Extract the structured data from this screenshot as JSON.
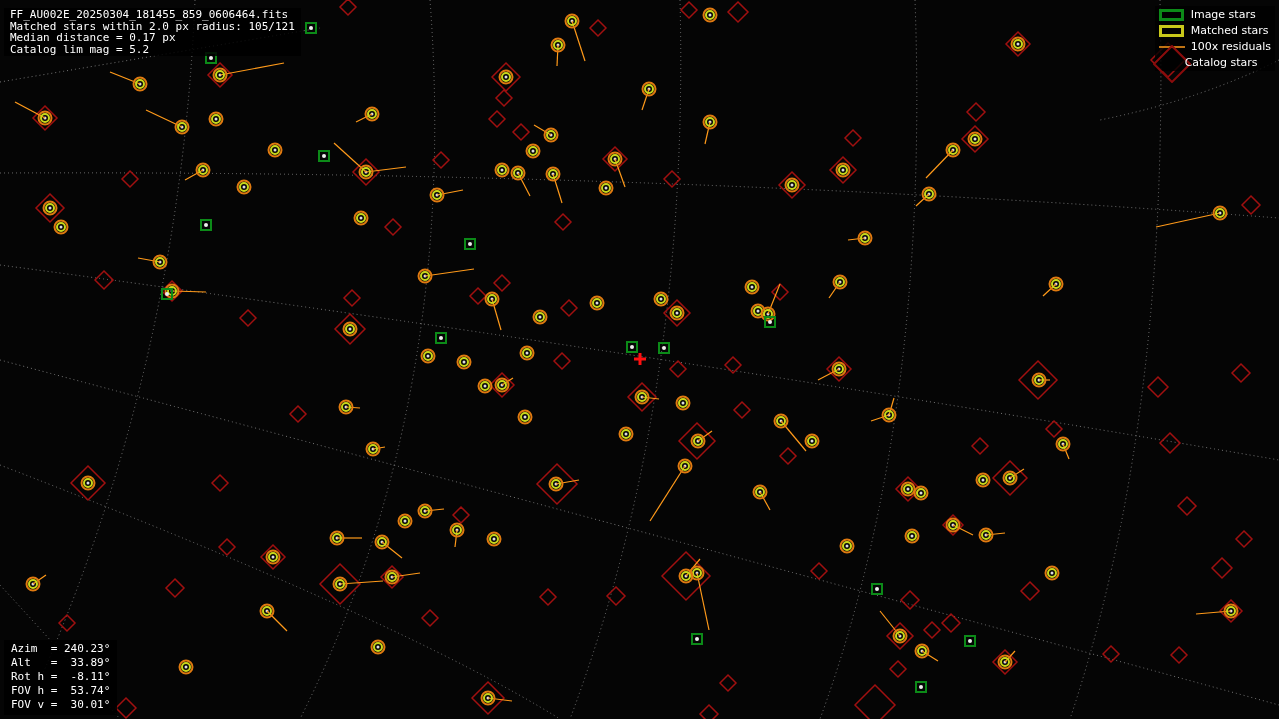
{
  "info": {
    "lines": [
      "FF_AU002E_20250304_181455_859_0606464.fits",
      "Matched stars within 2.0 px radius: 105/121",
      "Median distance = 0.17 px",
      "Catalog lim mag = 5.2"
    ]
  },
  "legend": [
    {
      "kind": "image",
      "label": "Image stars"
    },
    {
      "kind": "matched",
      "label": "Matched stars"
    },
    {
      "kind": "residual",
      "label": "100x residuals"
    },
    {
      "kind": "catalog",
      "label": "Catalog stars"
    }
  ],
  "pointing": {
    "lines": [
      "Azim  = 240.23°",
      "Alt   =  33.89°",
      "Rot h =  -8.11°",
      "FOV h =  53.74°",
      "FOV v =  30.01°"
    ]
  }
}
